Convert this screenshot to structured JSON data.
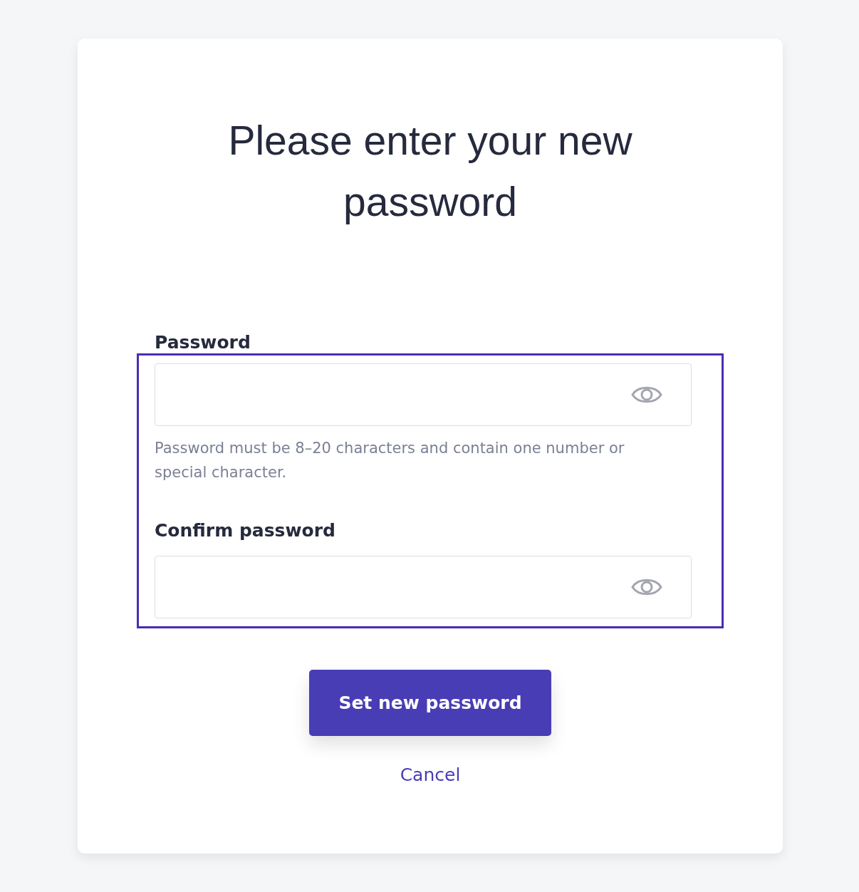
{
  "title": "Please enter your new password",
  "fields": [
    {
      "label": "Password",
      "hint": "Password must be 8–20 characters and contain one number or special character."
    },
    {
      "label": "Confirm password"
    }
  ],
  "fields_highlighted": true,
  "submit": "Set new password",
  "cancel": "Cancel"
}
